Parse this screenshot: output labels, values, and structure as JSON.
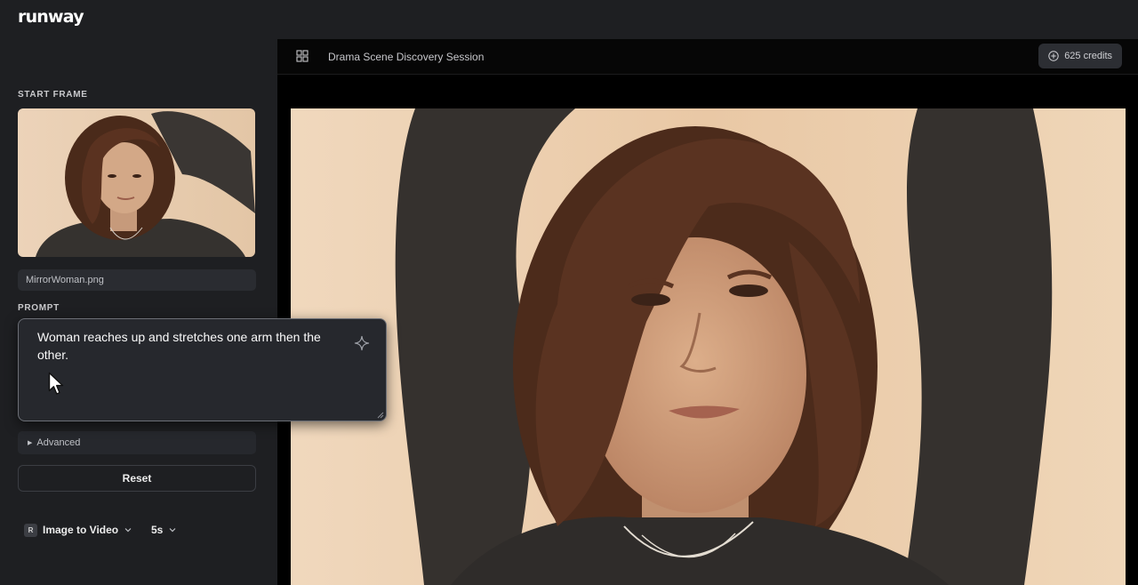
{
  "app": {
    "logo_text": "runway"
  },
  "sidebar": {
    "start_frame_label": "START FRAME",
    "file_name": "MirrorWoman.png",
    "prompt_label": "PROMPT",
    "prompt_text": "Woman reaches up and stretches one arm then the other.",
    "prompt_icon": "sparkle-icon",
    "advanced_label": "Advanced",
    "reset_label": "Reset",
    "mode": {
      "badge": "R",
      "label": "Image to Video"
    },
    "duration": "5s"
  },
  "header": {
    "view_icon": "grid-icon",
    "session_title": "Drama Scene Discovery Session",
    "credits": "625 credits"
  },
  "colors": {
    "sidebar_bg": "#1e1f22",
    "main_bg": "#000000",
    "prompt_border": "#6c6f76",
    "accent_text": "#ffffff"
  }
}
